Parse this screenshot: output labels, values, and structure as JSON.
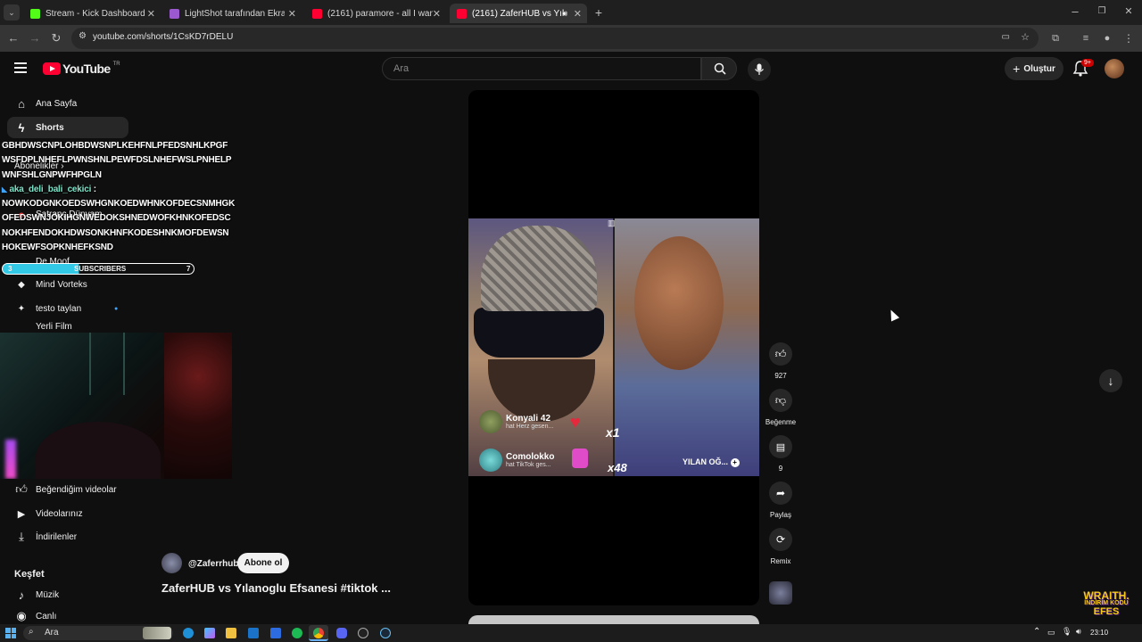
{
  "browser": {
    "tabs": [
      {
        "label": "Stream - Kick Dashboard",
        "color": "#53fc18"
      },
      {
        "label": "LightShot tarafından Ekran Gör",
        "color": "#9b59d0"
      },
      {
        "label": "(2161) paramore - all I wanted",
        "color": "#ff0033"
      },
      {
        "label": "(2161) ZaferHUB vs Yılanoğ",
        "color": "#ff0033"
      }
    ],
    "url": "youtube.com/shorts/1CsKD7rDELU"
  },
  "youtube": {
    "logo": "YouTube",
    "region": "TR",
    "search_placeholder": "Ara",
    "create_label": "Oluştur",
    "notif_badge": "9+"
  },
  "sidebar": {
    "top": [
      {
        "label": "Ana Sayfa",
        "icon": "home-icon"
      },
      {
        "label": "Shorts",
        "icon": "shorts-icon"
      }
    ],
    "subs_header": "Abonelikler",
    "subs": [
      {
        "label": "Satranç Dünyam"
      },
      {
        "label": "De Moof"
      },
      {
        "label": "Mind Vorteks"
      },
      {
        "label": "testo taylan"
      },
      {
        "label": "Yerli Film"
      }
    ],
    "you": [
      {
        "label": "Beğendiğim videolar",
        "icon": "like-icon"
      },
      {
        "label": "Videolarınız",
        "icon": "video-icon"
      },
      {
        "label": "İndirilenler",
        "icon": "download-icon"
      }
    ],
    "explore_header": "Keşfet",
    "explore": [
      {
        "label": "Müzik",
        "icon": "music-icon"
      },
      {
        "label": "Canlı",
        "icon": "live-icon"
      }
    ]
  },
  "overlay": {
    "chat_lines": [
      "GBHDWSCNPLOHBDWSNPLKEHFNLPFEDSNHLKPGF",
      "WSFDPLNHEFLPWNSHNLPEWFDSLNHEFWSLPNHELP",
      "WNFSHLGNPWFHPGLN"
    ],
    "chat_user": "aka_deli_bali_cekici",
    "chat_lines2": [
      "NOWKODGNKOEDSWHGNKOEDWHNKOFDECSNMHGK",
      "OFEDSWNJOKIHGNWEDOKSHNEDWOFKHNKOFEDSC",
      "NOKHFENDOKHDWSONKHNFKODESHNKMOFDEWSN",
      "HOKEWFSOPKNHEFKSND"
    ],
    "sub_left": "3",
    "sub_label": "SUBSCRIBERS",
    "sub_right": "7",
    "sub_fill_fraction": 0.4,
    "brand_line1": "WRAITH.",
    "brand_line2": "İNDİRİM KODU",
    "brand_line3": "EFES"
  },
  "video": {
    "comments": [
      {
        "name": "Konyali 42",
        "sub": "hat Herz gesen..."
      },
      {
        "name": "Comolokko",
        "sub": "hat TikTok ges..."
      }
    ],
    "x1": "x1",
    "x48": "x48",
    "right_channel": "YILAN OĞ...",
    "channel": "@Zaferrhub",
    "subscribe": "Abone ol",
    "title": "ZaferHUB vs Yılanoglu Efsanesi #tiktok ..."
  },
  "actions": {
    "likes": "927",
    "dislike_label": "Beğenme",
    "comments": "9",
    "share_label": "Paylaş",
    "remix_label": "Remix"
  },
  "taskbar": {
    "search": "Ara",
    "time": "23:10"
  }
}
